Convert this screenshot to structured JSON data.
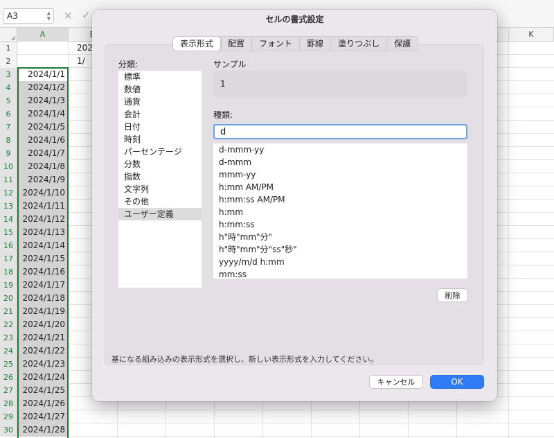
{
  "formula_bar": {
    "name_box": "A3"
  },
  "icons": {
    "cancel": "x-icon",
    "enter": "checkmark-icon",
    "name_box_arrows": "up-down-chevron-icon"
  },
  "columns": {
    "a": "A",
    "b": "B",
    "k": "K"
  },
  "rows": [
    {
      "num": "1",
      "a": "",
      "b": "202"
    },
    {
      "num": "2",
      "a": "",
      "b": "1/"
    },
    {
      "num": "3",
      "a": "2024/1/1",
      "b": ""
    },
    {
      "num": "4",
      "a": "2024/1/2",
      "b": ""
    },
    {
      "num": "5",
      "a": "2024/1/3",
      "b": ""
    },
    {
      "num": "6",
      "a": "2024/1/4",
      "b": ""
    },
    {
      "num": "7",
      "a": "2024/1/5",
      "b": ""
    },
    {
      "num": "8",
      "a": "2024/1/6",
      "b": ""
    },
    {
      "num": "9",
      "a": "2024/1/7",
      "b": ""
    },
    {
      "num": "10",
      "a": "2024/1/8",
      "b": ""
    },
    {
      "num": "11",
      "a": "2024/1/9",
      "b": ""
    },
    {
      "num": "12",
      "a": "2024/1/10",
      "b": ""
    },
    {
      "num": "13",
      "a": "2024/1/11",
      "b": ""
    },
    {
      "num": "14",
      "a": "2024/1/12",
      "b": ""
    },
    {
      "num": "15",
      "a": "2024/1/13",
      "b": ""
    },
    {
      "num": "16",
      "a": "2024/1/14",
      "b": ""
    },
    {
      "num": "17",
      "a": "2024/1/15",
      "b": ""
    },
    {
      "num": "18",
      "a": "2024/1/16",
      "b": ""
    },
    {
      "num": "19",
      "a": "2024/1/17",
      "b": ""
    },
    {
      "num": "20",
      "a": "2024/1/18",
      "b": ""
    },
    {
      "num": "21",
      "a": "2024/1/19",
      "b": ""
    },
    {
      "num": "22",
      "a": "2024/1/20",
      "b": ""
    },
    {
      "num": "23",
      "a": "2024/1/21",
      "b": ""
    },
    {
      "num": "24",
      "a": "2024/1/22",
      "b": ""
    },
    {
      "num": "25",
      "a": "2024/1/23",
      "b": ""
    },
    {
      "num": "26",
      "a": "2024/1/24",
      "b": ""
    },
    {
      "num": "27",
      "a": "2024/1/25",
      "b": ""
    },
    {
      "num": "28",
      "a": "2024/1/26",
      "b": ""
    },
    {
      "num": "29",
      "a": "2024/1/27",
      "b": ""
    },
    {
      "num": "30",
      "a": "2024/1/28",
      "b": ""
    }
  ],
  "dialog": {
    "title": "セルの書式設定",
    "tabs": [
      {
        "label": "表示形式",
        "active": true
      },
      {
        "label": "配置",
        "active": false
      },
      {
        "label": "フォント",
        "active": false
      },
      {
        "label": "罫線",
        "active": false
      },
      {
        "label": "塗りつぶし",
        "active": false
      },
      {
        "label": "保護",
        "active": false
      }
    ],
    "category_label": "分類:",
    "categories": [
      {
        "label": "標準",
        "selected": false
      },
      {
        "label": "数値",
        "selected": false
      },
      {
        "label": "通貨",
        "selected": false
      },
      {
        "label": "会計",
        "selected": false
      },
      {
        "label": "日付",
        "selected": false
      },
      {
        "label": "時刻",
        "selected": false
      },
      {
        "label": "パーセンテージ",
        "selected": false
      },
      {
        "label": "分数",
        "selected": false
      },
      {
        "label": "指数",
        "selected": false
      },
      {
        "label": "文字列",
        "selected": false
      },
      {
        "label": "その他",
        "selected": false
      },
      {
        "label": "ユーザー定義",
        "selected": true
      }
    ],
    "sample_label": "サンプル",
    "sample_value": "1",
    "type_label": "種類:",
    "type_input_value": "d",
    "formats": [
      "d-mmm-yy",
      "d-mmm",
      "mmm-yy",
      "h:mm AM/PM",
      "h:mm:ss AM/PM",
      "h:mm",
      "h:mm:ss",
      "h\"時\"mm\"分\"",
      "h\"時\"mm\"分\"ss\"秒\"",
      "yyyy/m/d h:mm",
      "mm:ss"
    ],
    "delete_label": "削除",
    "help_text": "基になる組み込みの表示形式を選択し、新しい表示形式を入力してください。",
    "cancel_label": "キャンセル",
    "ok_label": "OK"
  },
  "colors": {
    "accent": "#2f7cf6",
    "selection_border": "#1e7a38",
    "focus_ring": "#6aa2e8"
  }
}
